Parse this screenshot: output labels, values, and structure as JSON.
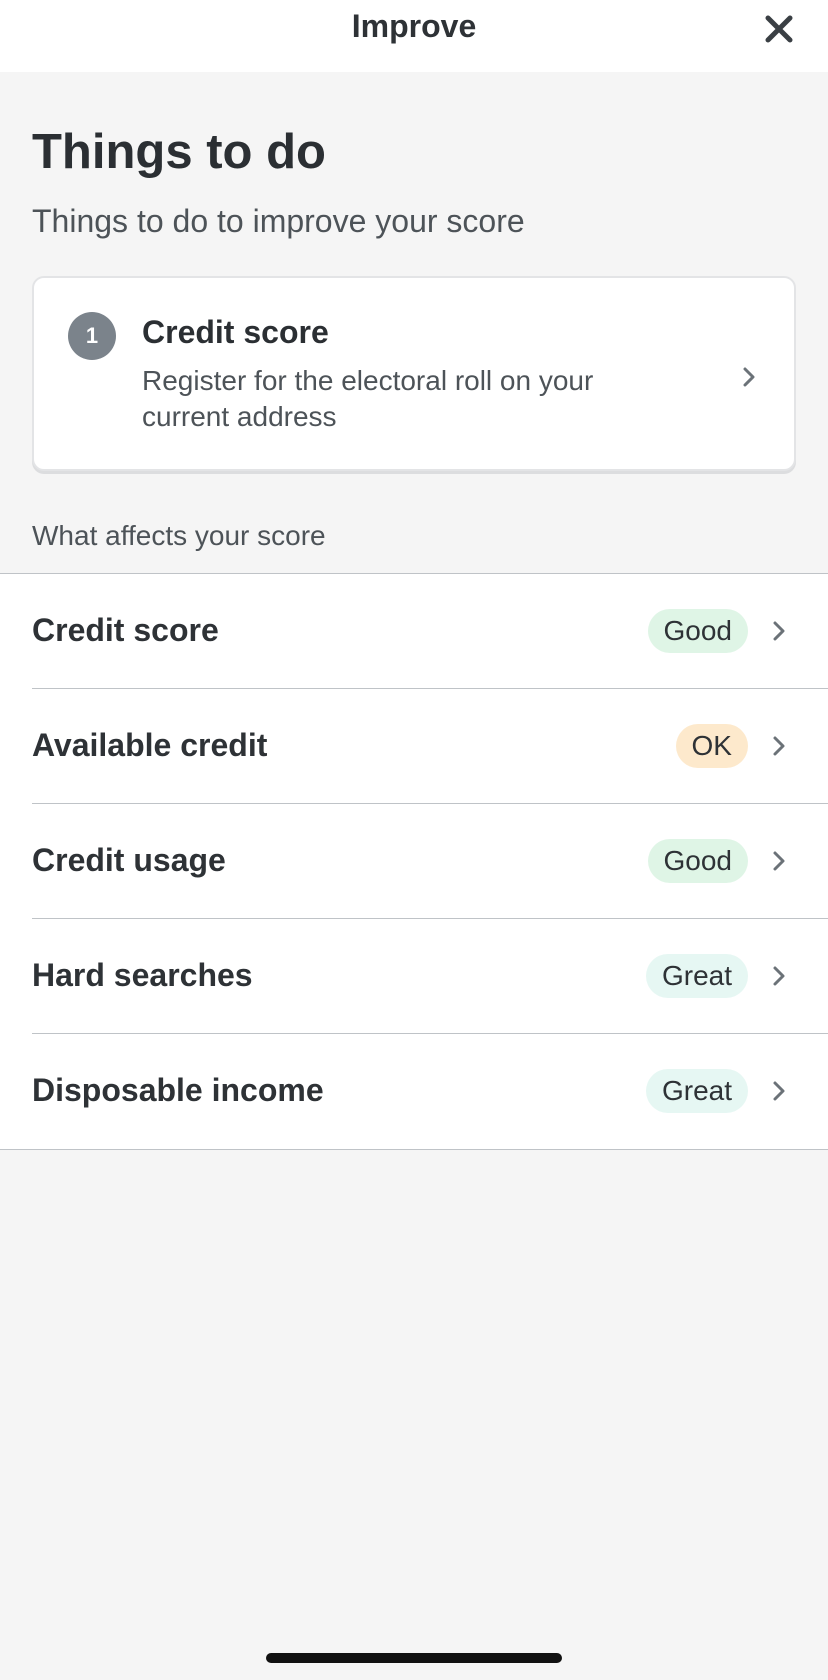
{
  "header": {
    "title": "Improve",
    "close_icon": "close-icon"
  },
  "main": {
    "title": "Things to do",
    "subtitle": "Things to do to improve your score",
    "todo_card": {
      "step_number": "1",
      "title": "Credit score",
      "description": "Register for the electoral roll on your current address",
      "icon": "chevron-right-icon"
    },
    "section_label": "What affects your score",
    "factors": [
      {
        "label": "Credit score",
        "rating": "Good",
        "badge_color": "#dff5e6"
      },
      {
        "label": "Available credit",
        "rating": "OK",
        "badge_color": "#fde9cc"
      },
      {
        "label": "Credit usage",
        "rating": "Good",
        "badge_color": "#dff5e6"
      },
      {
        "label": "Hard searches",
        "rating": "Great",
        "badge_color": "#e6f7f3"
      },
      {
        "label": "Disposable income",
        "rating": "Great",
        "badge_color": "#e6f7f3"
      }
    ]
  },
  "colors": {
    "background": "#f5f5f5",
    "card": "#ffffff",
    "step_badge": "#7b838b",
    "good": "#dff5e6",
    "ok": "#fde9cc",
    "great": "#e6f7f3"
  }
}
